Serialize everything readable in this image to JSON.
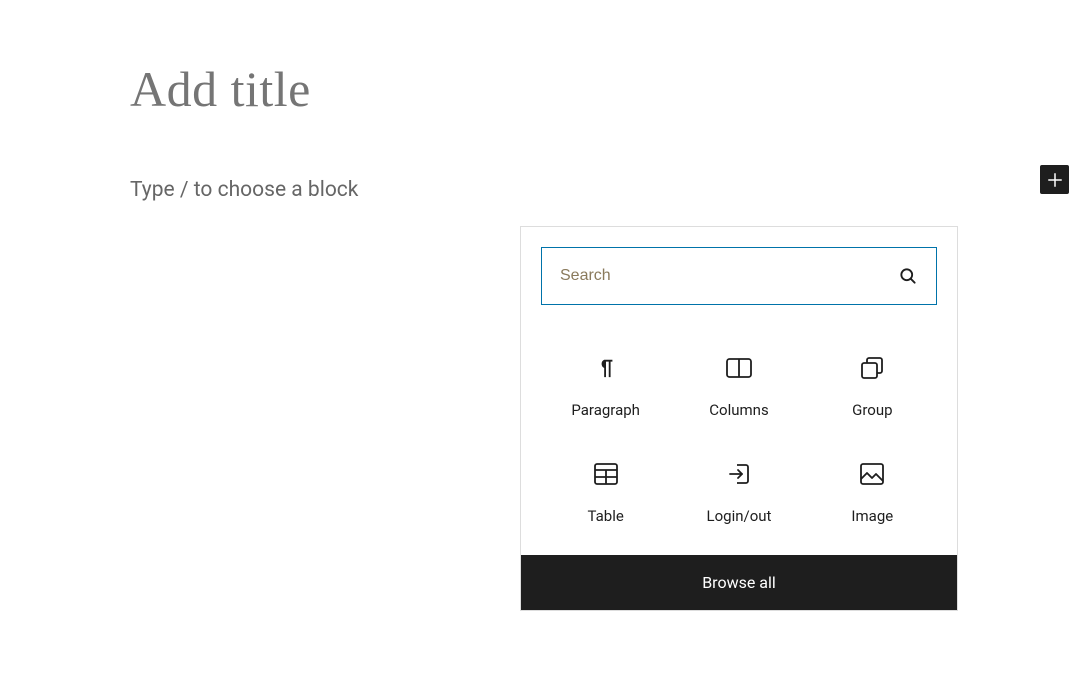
{
  "editor": {
    "title_placeholder": "Add title",
    "block_prompt": "Type / to choose a block"
  },
  "inserter": {
    "search_placeholder": "Search",
    "blocks": [
      {
        "label": "Paragraph",
        "icon": "paragraph"
      },
      {
        "label": "Columns",
        "icon": "columns"
      },
      {
        "label": "Group",
        "icon": "group"
      },
      {
        "label": "Table",
        "icon": "table"
      },
      {
        "label": "Login/out",
        "icon": "login"
      },
      {
        "label": "Image",
        "icon": "image"
      }
    ],
    "browse_all": "Browse all"
  }
}
